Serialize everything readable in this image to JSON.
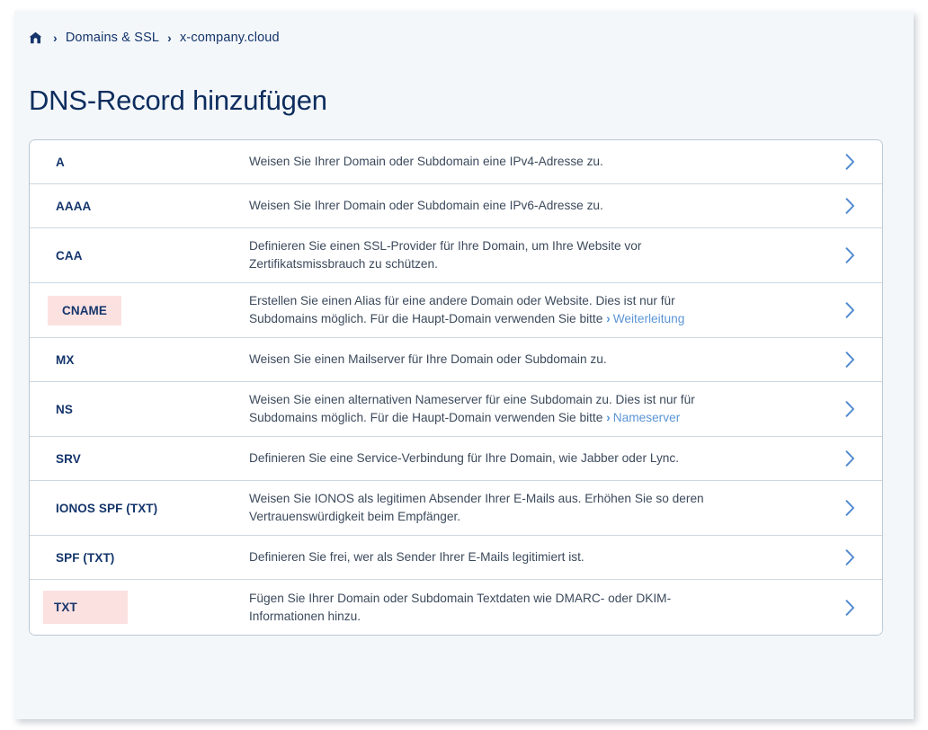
{
  "window": {
    "page_background": "#f4f7fa",
    "card_background": "#ffffff",
    "accent_blue": "#4e88cf",
    "link_blue": "#5b95d6",
    "title_navy": "#0d2d5e",
    "highlight_pink": "#fce1e1",
    "row_divider": "#ccd8e2"
  },
  "breadcrumb": {
    "home_icon": "home-icon",
    "separator": "›",
    "items": [
      {
        "label": "Domains & SSL"
      },
      {
        "label": "x-company.cloud"
      }
    ]
  },
  "page": {
    "title": "DNS-Record hinzufügen"
  },
  "record_list": {
    "chevron_icon": "chevron-right-icon",
    "rows": [
      {
        "type": "A",
        "highlighted": false,
        "description": "Weisen Sie Ihrer Domain oder Subdomain eine IPv4-Adresse zu.",
        "link": null,
        "lines": 1
      },
      {
        "type": "AAAA",
        "highlighted": false,
        "description": "Weisen Sie Ihrer Domain oder Subdomain eine IPv6-Adresse zu.",
        "link": null,
        "lines": 1
      },
      {
        "type": "CAA",
        "highlighted": false,
        "description": "Definieren Sie einen SSL-Provider für Ihre Domain, um Ihre Website vor Zertifikatsmissbrauch zu schützen.",
        "link": null,
        "lines": 2
      },
      {
        "type": "CNAME",
        "highlighted": true,
        "description": "Erstellen Sie einen Alias für eine andere Domain oder Website. Dies ist nur für Subdomains möglich. Für die Haupt-Domain verwenden Sie bitte",
        "link": "Weiterleitung",
        "lines": 2
      },
      {
        "type": "MX",
        "highlighted": false,
        "description": "Weisen Sie einen Mailserver für Ihre Domain oder Subdomain zu.",
        "link": null,
        "lines": 1
      },
      {
        "type": "NS",
        "highlighted": false,
        "description": "Weisen Sie einen alternativen Nameserver für eine Subdomain zu. Dies ist nur für Subdomains möglich. Für die Haupt-Domain verwenden Sie bitte",
        "link": "Nameserver",
        "lines": 2
      },
      {
        "type": "SRV",
        "highlighted": false,
        "description": "Definieren Sie eine Service-Verbindung für Ihre Domain, wie Jabber oder Lync.",
        "link": null,
        "lines": 1
      },
      {
        "type": "IONOS SPF (TXT)",
        "highlighted": false,
        "description": "Weisen Sie IONOS als legitimen Absender Ihrer E-Mails aus. Erhöhen Sie so deren Vertrauenswürdigkeit beim Empfänger.",
        "link": null,
        "lines": 2
      },
      {
        "type": "SPF (TXT)",
        "highlighted": false,
        "description": "Definieren Sie frei, wer als Sender Ihrer E-Mails legitimiert ist.",
        "link": null,
        "lines": 1
      },
      {
        "type": "TXT",
        "highlighted": true,
        "description": "Fügen Sie Ihrer Domain oder Subdomain Textdaten wie DMARC- oder DKIM-Informationen hinzu.",
        "link": null,
        "lines": 2,
        "chip_wide": true
      }
    ]
  }
}
